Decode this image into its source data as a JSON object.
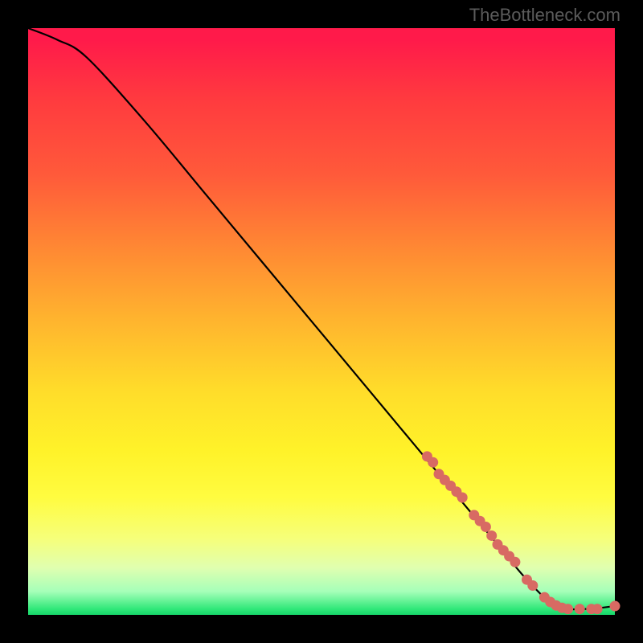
{
  "watermark": "TheBottleneck.com",
  "colors": {
    "page_bg": "#000000",
    "curve": "#000000",
    "marker_fill": "#d86a63",
    "marker_stroke": "#c45a54"
  },
  "chart_data": {
    "type": "line",
    "title": "",
    "xlabel": "",
    "ylabel": "",
    "xlim": [
      0,
      100
    ],
    "ylim": [
      0,
      100
    ],
    "grid": false,
    "legend": false,
    "series": [
      {
        "name": "curve",
        "style": "line",
        "x": [
          0,
          5,
          10,
          20,
          30,
          40,
          50,
          60,
          70,
          75,
          80,
          85,
          90,
          95,
          100
        ],
        "y": [
          100,
          98,
          95,
          84,
          72,
          60,
          48,
          36,
          24,
          18,
          12,
          6,
          1.5,
          1.0,
          1.5
        ]
      },
      {
        "name": "markers",
        "style": "points",
        "x": [
          68,
          69,
          70,
          71,
          72,
          73,
          74,
          76,
          77,
          78,
          79,
          80,
          81,
          82,
          83,
          85,
          86,
          88,
          89,
          90,
          91,
          92,
          94,
          96,
          97,
          100
        ],
        "y": [
          27,
          26,
          24,
          23,
          22,
          21,
          20,
          17,
          16,
          15,
          13.5,
          12,
          11,
          10,
          9,
          6,
          5,
          3,
          2.2,
          1.6,
          1.2,
          1.0,
          1.0,
          1.0,
          1.0,
          1.5
        ]
      }
    ]
  }
}
